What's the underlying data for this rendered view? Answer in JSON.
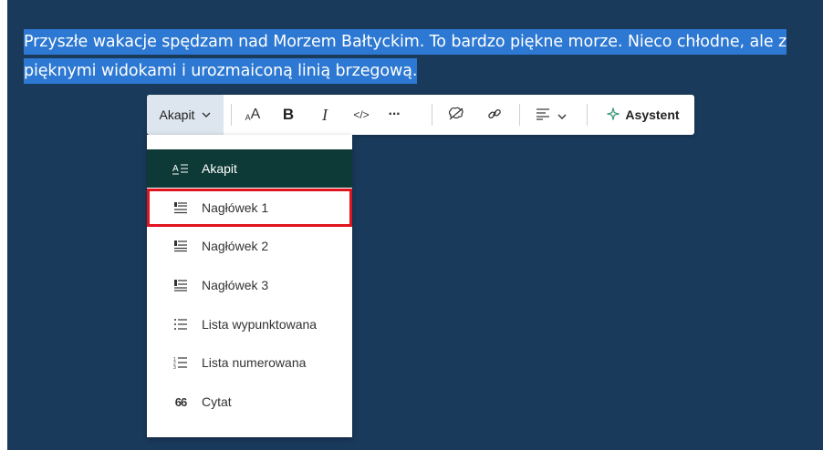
{
  "paragraph": {
    "line1": "Przyszłe wakacje spędzam nad Morzem Bałtyckim. To bardzo piękne morze. Nieco chłodne, ale z",
    "line2": "pięknymi widokami i urozmaiconą linią brzegową."
  },
  "toolbar": {
    "style_label": "Akapit",
    "font_size_icon": "font-size-icon",
    "bold_label": "B",
    "italic_label": "I",
    "code_label": "</>",
    "more_label": "···",
    "assistant_label": "Asystent"
  },
  "menu": {
    "items": [
      {
        "label": "Akapit",
        "icon": "paragraph-icon"
      },
      {
        "label": "Nagłówek 1",
        "icon": "heading-1-icon"
      },
      {
        "label": "Nagłówek 2",
        "icon": "heading-2-icon"
      },
      {
        "label": "Nagłówek 3",
        "icon": "heading-3-icon"
      },
      {
        "label": "Lista wypunktowana",
        "icon": "bulleted-list-icon"
      },
      {
        "label": "Lista numerowana",
        "icon": "numbered-list-icon"
      },
      {
        "label": "Cytat",
        "icon": "quote-icon"
      }
    ],
    "icon_glyphs": [
      "A≡",
      "",
      "",
      "",
      "",
      "",
      "66"
    ]
  },
  "colors": {
    "editor_bg": "#1a3a5c",
    "selection": "#2d78d2",
    "active_item": "#0d3a36",
    "highlight": "#e0141e"
  }
}
